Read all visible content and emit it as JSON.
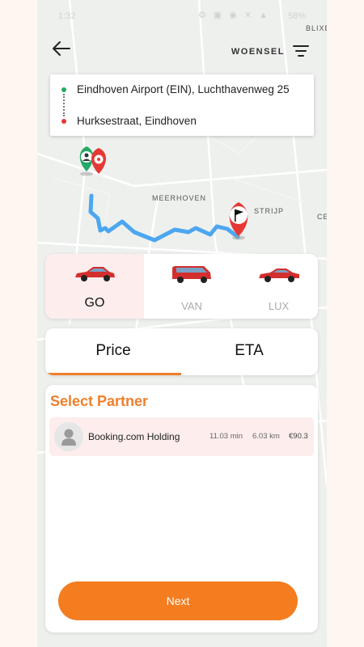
{
  "status_bar": {
    "time": "1:32",
    "icons": "⚙ ▣ ◉ ✕ ▲",
    "battery": "58%"
  },
  "header": {
    "area_label": "WOENSEL",
    "back_icon": "arrow-left-icon",
    "filter_icon": "filter-icon"
  },
  "route": {
    "from": "Eindhoven Airport (EIN), Luchthavenweg 25",
    "to": "Hurksestraat, Eindhoven"
  },
  "map": {
    "labels": [
      "MEERHOVEN",
      "STRIJP",
      "BLIXE",
      "CE"
    ]
  },
  "vehicles": [
    {
      "label": "GO",
      "selected": true
    },
    {
      "label": "VAN",
      "selected": false
    },
    {
      "label": "LUX",
      "selected": false
    }
  ],
  "sort_tabs": [
    {
      "label": "Price",
      "selected": true
    },
    {
      "label": "ETA",
      "selected": false
    }
  ],
  "partners": {
    "title": "Select Partner",
    "items": [
      {
        "name": "Booking.com Holding",
        "time": "11.03 min",
        "distance": "6.03 km",
        "price": "€90.3"
      }
    ]
  },
  "next_label": "Next",
  "colors": {
    "accent": "#f47d20",
    "route": "#4da6f0",
    "pin_red": "#e53935",
    "pin_green": "#22aa66"
  }
}
